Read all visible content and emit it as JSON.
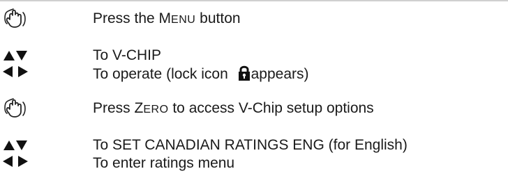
{
  "steps": [
    {
      "icon": "press-hand-icon",
      "lines": [
        {
          "pre": "Press the ",
          "sc_first": "M",
          "sc_rest": "ENU",
          "post": " button"
        }
      ]
    },
    {
      "icon": "arrow-keys-icon",
      "lines": [
        {
          "text": "To V-CHIP"
        },
        {
          "pre": "To operate (lock icon ",
          "icon": "lock-icon",
          "post": "appears)"
        }
      ]
    },
    {
      "icon": "press-hand-icon",
      "lines": [
        {
          "pre": "Press ",
          "sc_first": "Z",
          "sc_rest": "ERO",
          "post": " to access V-Chip setup options"
        }
      ]
    },
    {
      "icon": "arrow-keys-icon",
      "lines": [
        {
          "text": "To SET CANADIAN RATINGS ENG (for English)"
        },
        {
          "text": "To enter ratings menu"
        }
      ]
    }
  ]
}
